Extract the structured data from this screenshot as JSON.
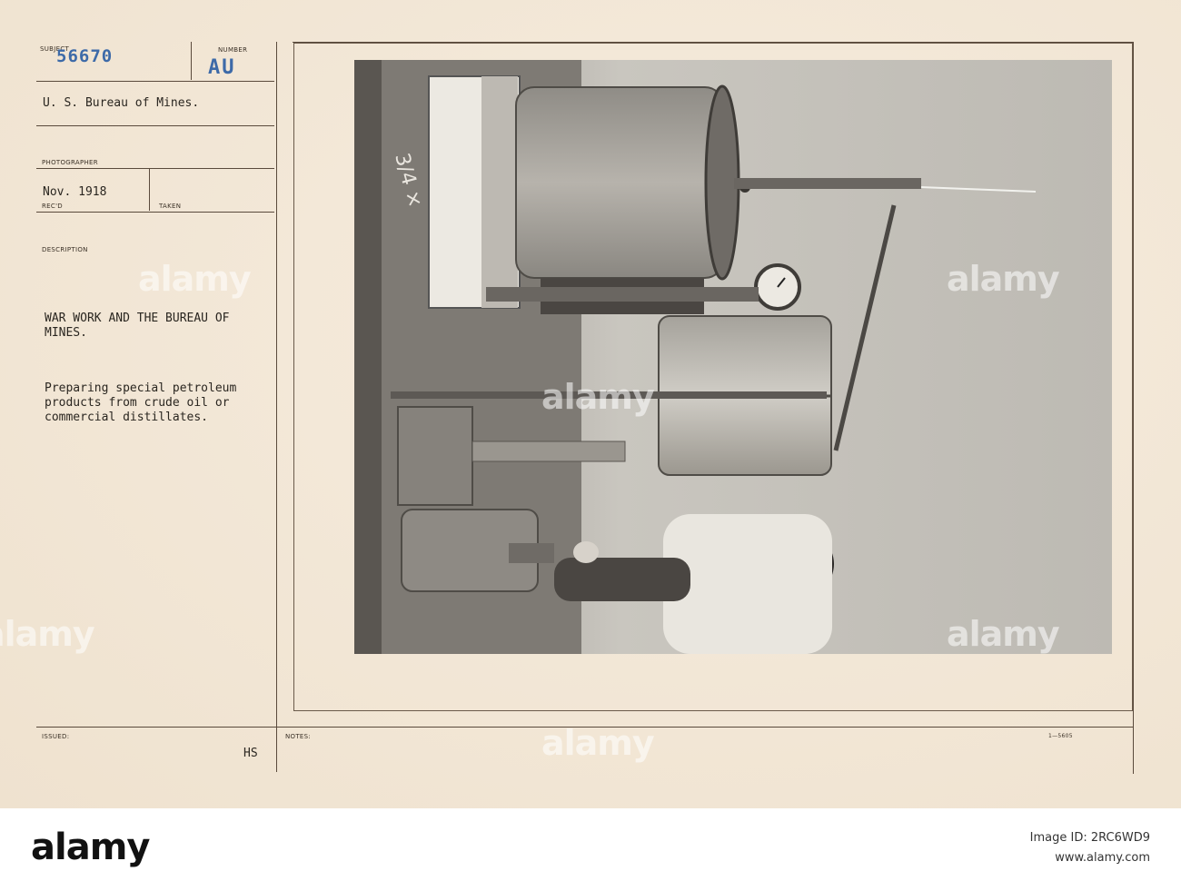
{
  "card": {
    "subject_label": "SUBJECT",
    "subject_number": "56670",
    "number_label": "NUMBER",
    "number_value": "AU",
    "agency": "U. S. Bureau of Mines.",
    "photographer_label": "PHOTOGRAPHER",
    "date": "Nov. 1918",
    "recd_label": "REC'D",
    "taken_label": "TAKEN",
    "description_label": "DESCRIPTION",
    "description_title": [
      "WAR WORK AND THE BUREAU OF",
      "MINES."
    ],
    "description_body": [
      "Preparing special petroleum",
      "products from crude oil or",
      "commercial distillates."
    ],
    "issued_label": "ISSUED:",
    "issued_value": "HS",
    "notes_label": "NOTES:",
    "form_code": "1—5605"
  },
  "photo": {
    "handwritten_mark": "3/4 ×"
  },
  "watermark_text": "alamy",
  "footer": {
    "logo": "alamy",
    "image_id": "Image ID: 2RC6WD9",
    "url": "www.alamy.com"
  },
  "colors": {
    "card": "#f3e8d8",
    "ink": "#2a2620",
    "stamp_blue": "#3d6aa8"
  }
}
